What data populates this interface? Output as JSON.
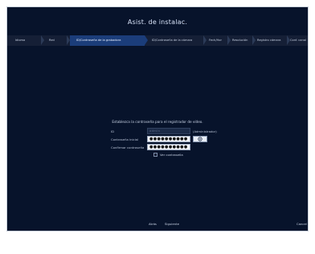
{
  "window": {
    "title": "Asist. de instalac."
  },
  "nav": {
    "steps": [
      {
        "label": "Idioma"
      },
      {
        "label": "Red"
      },
      {
        "label": "ID/Contraseña de la grabadora"
      },
      {
        "label": "ID/Contraseña de la cámara"
      },
      {
        "label": "Fech/Hor"
      },
      {
        "label": "Resolución"
      },
      {
        "label": "Registro cámara"
      },
      {
        "label": "Conf. canal"
      }
    ],
    "active_index": 2
  },
  "form": {
    "instruction": "Establezca la contraseña para el registrador de vídeo.",
    "id_label": "ID",
    "id_value": "admin",
    "id_role": "(Administrador)",
    "initial_password_label": "Contraseña inicial",
    "initial_password_value": "●●●●●●●●●●",
    "confirm_password_label": "Confirmar contraseña",
    "confirm_password_value": "●●●●●●●●●●",
    "show_password_label": "Ver contraseña"
  },
  "footer": {
    "back_label": "Atrás",
    "next_label": "Siguiente",
    "cancel_label": "Cancel"
  },
  "colors": {
    "background": "#07132b",
    "nav_bar": "#151f36",
    "active_step": "#1b3d7a",
    "text": "#c9d3e5"
  },
  "icons": {
    "show_password_button": "eye-icon"
  }
}
